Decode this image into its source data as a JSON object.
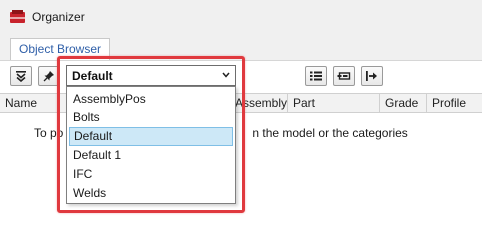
{
  "window": {
    "title": "Organizer"
  },
  "tabs": [
    {
      "label": "Object Browser"
    }
  ],
  "toolbar": {
    "buttons": [
      "collapse-all-icon",
      "pin-icon",
      "list-view-icon",
      "property-view-icon",
      "export-icon"
    ]
  },
  "combo": {
    "selected": "Default",
    "options": [
      "AssemblyPos",
      "Bolts",
      "Default",
      "Default 1",
      "IFC",
      "Welds"
    ],
    "selected_index": 2
  },
  "table": {
    "columns": [
      "Name",
      "Assembly",
      "Part",
      "Grade",
      "Profile"
    ]
  },
  "message": {
    "prefix": "To po",
    "suffix": "n the model or the categories"
  },
  "colors": {
    "highlight": "#e0393e",
    "selection": "#cde8f7",
    "tab_text": "#2f5fa8"
  }
}
